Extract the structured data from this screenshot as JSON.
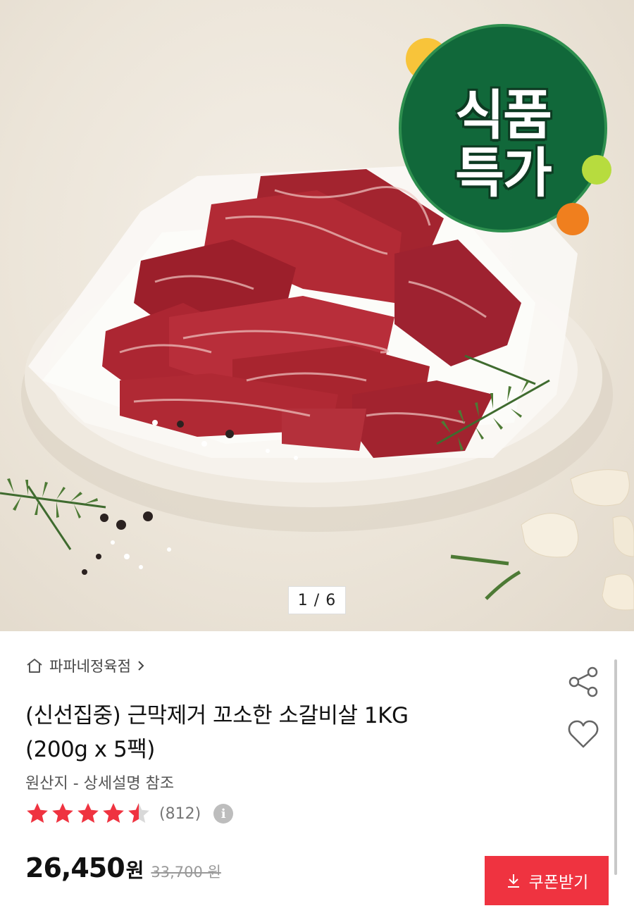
{
  "gallery": {
    "counter": "1 / 6",
    "badge_line1": "식품",
    "badge_line2": "특가"
  },
  "product": {
    "seller": "파파네정육점",
    "title_line1": "(신선집중) 근막제거 꼬소한 소갈비살 1KG",
    "title_line2": "(200g x 5팩)",
    "origin": "원산지 - 상세설명 참조",
    "rating_value": 4.5,
    "rating_max": 5,
    "review_count": "(812)",
    "price": "26,450",
    "price_unit": "원",
    "original_price": "33,700 원",
    "coupon_label": "쿠폰받기"
  },
  "icons": {
    "seller": "home-icon",
    "share": "share-icon",
    "like": "heart-icon",
    "info": "info-icon",
    "download": "download-icon"
  },
  "colors": {
    "accent": "#ef3340",
    "star": "#ef3340",
    "badge": "#11683a"
  }
}
